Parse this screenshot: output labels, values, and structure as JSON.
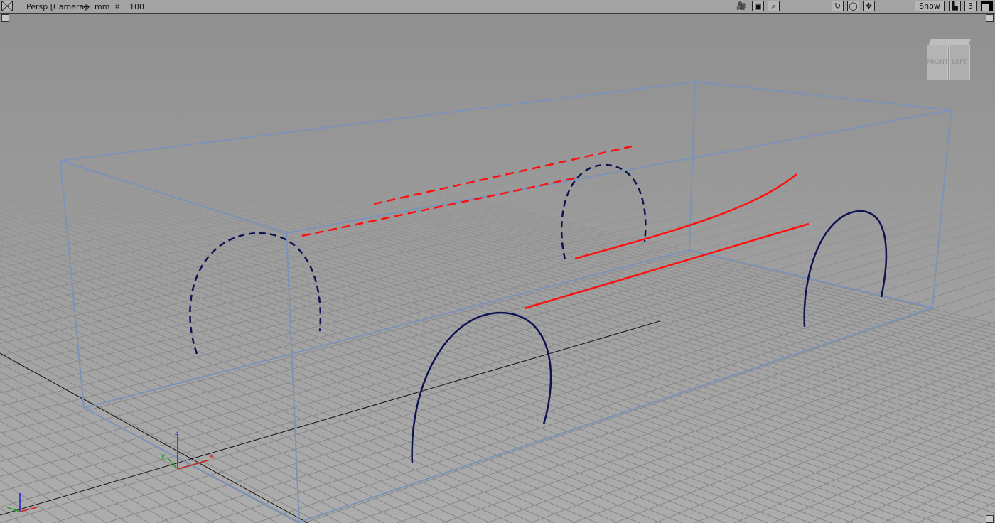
{
  "toolbar": {
    "view_name": "Persp [Camera]",
    "units_icon": "double-arrow-icon",
    "units": "mm",
    "grid_icon": "grid-spacing-icon",
    "grid_spacing": "100",
    "show_label": "Show",
    "layer_count": "3",
    "icons": [
      "close-window-icon",
      "camera-tumble-icon",
      "camera-icon",
      "zoom-icon",
      "rotate-icon",
      "frame-icon",
      "pan-move-icon",
      "ruler-icon",
      "window-toggle-icon"
    ]
  },
  "viewcube": {
    "front": "FRONT",
    "left": "LEFT"
  },
  "axes": {
    "x": "x",
    "y": "y",
    "z": "z"
  },
  "colors": {
    "box": "#7b93b8",
    "arch": "#0d1350",
    "red": "#ff1010",
    "grid": "#8a8a8a",
    "background": "#9c9c9c"
  }
}
